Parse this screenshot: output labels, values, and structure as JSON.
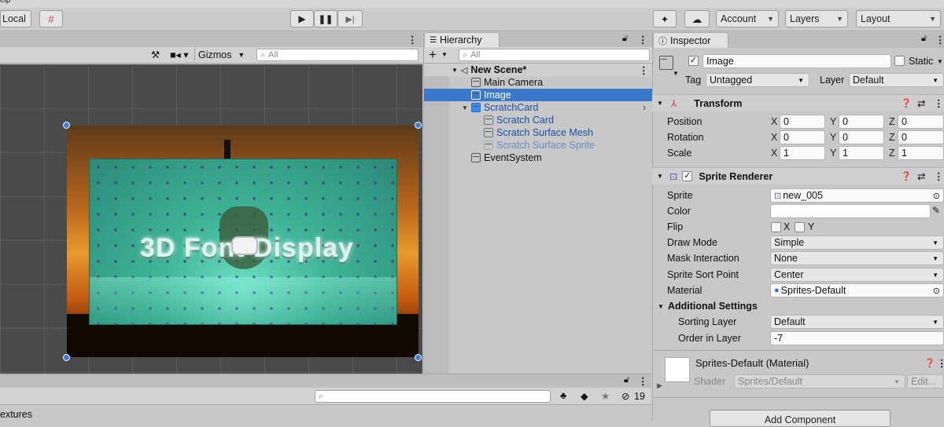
{
  "menu": {
    "partial": "elp"
  },
  "toolbar": {
    "local_label": "Local",
    "account_label": "Account",
    "layers_label": "Layers",
    "layout_label": "Layout"
  },
  "scene": {
    "gizmos_label": "Gizmos",
    "search_placeholder": "All",
    "game_overlay_text": "3D Font Display"
  },
  "hierarchy": {
    "tab_label": "Hierarchy",
    "search_placeholder": "All",
    "items": [
      {
        "label": "New Scene*"
      },
      {
        "label": "Main Camera"
      },
      {
        "label": "Image"
      },
      {
        "label": "ScratchCard"
      },
      {
        "label": "Scratch Card"
      },
      {
        "label": "Scratch Surface Mesh"
      },
      {
        "label": "Scratch Surface Sprite"
      },
      {
        "label": "EventSystem"
      }
    ]
  },
  "project": {
    "folder_partial": "extures",
    "hidden_count": "19"
  },
  "inspector": {
    "tab_label": "Inspector",
    "object_name": "Image",
    "static_label": "Static",
    "tag_label": "Tag",
    "tag_value": "Untagged",
    "layer_label": "Layer",
    "layer_value": "Default",
    "transform": {
      "title": "Transform",
      "rows": [
        {
          "label": "Position",
          "x": "0",
          "y": "0",
          "z": "0"
        },
        {
          "label": "Rotation",
          "x": "0",
          "y": "0",
          "z": "0"
        },
        {
          "label": "Scale",
          "x": "1",
          "y": "1",
          "z": "1"
        }
      ],
      "axis_x": "X",
      "axis_y": "Y",
      "axis_z": "Z"
    },
    "sprite_renderer": {
      "title": "Sprite Renderer",
      "sprite_label": "Sprite",
      "sprite_value": "new_005",
      "color_label": "Color",
      "flip_label": "Flip",
      "flip_x": "X",
      "flip_y": "Y",
      "draw_mode_label": "Draw Mode",
      "draw_mode_value": "Simple",
      "mask_label": "Mask Interaction",
      "mask_value": "None",
      "sort_point_label": "Sprite Sort Point",
      "sort_point_value": "Center",
      "material_label": "Material",
      "material_value": "Sprites-Default",
      "additional_label": "Additional Settings",
      "sorting_layer_label": "Sorting Layer",
      "sorting_layer_value": "Default",
      "order_label": "Order in Layer",
      "order_value": "-7"
    },
    "material": {
      "title": "Sprites-Default (Material)",
      "shader_label": "Shader",
      "shader_value": "Sprites/Default",
      "edit_label": "Edit..."
    },
    "add_component_label": "Add Component"
  }
}
